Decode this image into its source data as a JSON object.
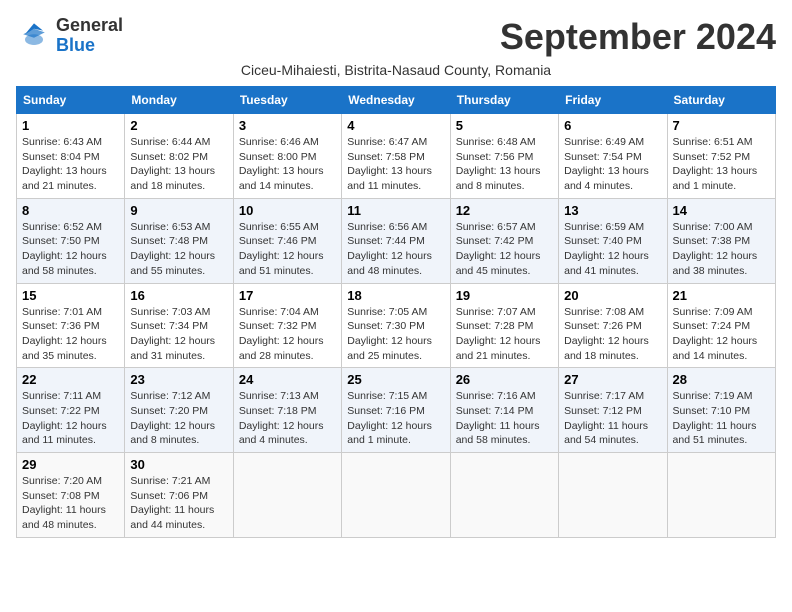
{
  "logo": {
    "line1": "General",
    "line2": "Blue"
  },
  "title": "September 2024",
  "location": "Ciceu-Mihaiesti, Bistrita-Nasaud County, Romania",
  "days_header": [
    "Sunday",
    "Monday",
    "Tuesday",
    "Wednesday",
    "Thursday",
    "Friday",
    "Saturday"
  ],
  "weeks": [
    [
      {
        "day": "1",
        "text": "Sunrise: 6:43 AM\nSunset: 8:04 PM\nDaylight: 13 hours and 21 minutes."
      },
      {
        "day": "2",
        "text": "Sunrise: 6:44 AM\nSunset: 8:02 PM\nDaylight: 13 hours and 18 minutes."
      },
      {
        "day": "3",
        "text": "Sunrise: 6:46 AM\nSunset: 8:00 PM\nDaylight: 13 hours and 14 minutes."
      },
      {
        "day": "4",
        "text": "Sunrise: 6:47 AM\nSunset: 7:58 PM\nDaylight: 13 hours and 11 minutes."
      },
      {
        "day": "5",
        "text": "Sunrise: 6:48 AM\nSunset: 7:56 PM\nDaylight: 13 hours and 8 minutes."
      },
      {
        "day": "6",
        "text": "Sunrise: 6:49 AM\nSunset: 7:54 PM\nDaylight: 13 hours and 4 minutes."
      },
      {
        "day": "7",
        "text": "Sunrise: 6:51 AM\nSunset: 7:52 PM\nDaylight: 13 hours and 1 minute."
      }
    ],
    [
      {
        "day": "8",
        "text": "Sunrise: 6:52 AM\nSunset: 7:50 PM\nDaylight: 12 hours and 58 minutes."
      },
      {
        "day": "9",
        "text": "Sunrise: 6:53 AM\nSunset: 7:48 PM\nDaylight: 12 hours and 55 minutes."
      },
      {
        "day": "10",
        "text": "Sunrise: 6:55 AM\nSunset: 7:46 PM\nDaylight: 12 hours and 51 minutes."
      },
      {
        "day": "11",
        "text": "Sunrise: 6:56 AM\nSunset: 7:44 PM\nDaylight: 12 hours and 48 minutes."
      },
      {
        "day": "12",
        "text": "Sunrise: 6:57 AM\nSunset: 7:42 PM\nDaylight: 12 hours and 45 minutes."
      },
      {
        "day": "13",
        "text": "Sunrise: 6:59 AM\nSunset: 7:40 PM\nDaylight: 12 hours and 41 minutes."
      },
      {
        "day": "14",
        "text": "Sunrise: 7:00 AM\nSunset: 7:38 PM\nDaylight: 12 hours and 38 minutes."
      }
    ],
    [
      {
        "day": "15",
        "text": "Sunrise: 7:01 AM\nSunset: 7:36 PM\nDaylight: 12 hours and 35 minutes."
      },
      {
        "day": "16",
        "text": "Sunrise: 7:03 AM\nSunset: 7:34 PM\nDaylight: 12 hours and 31 minutes."
      },
      {
        "day": "17",
        "text": "Sunrise: 7:04 AM\nSunset: 7:32 PM\nDaylight: 12 hours and 28 minutes."
      },
      {
        "day": "18",
        "text": "Sunrise: 7:05 AM\nSunset: 7:30 PM\nDaylight: 12 hours and 25 minutes."
      },
      {
        "day": "19",
        "text": "Sunrise: 7:07 AM\nSunset: 7:28 PM\nDaylight: 12 hours and 21 minutes."
      },
      {
        "day": "20",
        "text": "Sunrise: 7:08 AM\nSunset: 7:26 PM\nDaylight: 12 hours and 18 minutes."
      },
      {
        "day": "21",
        "text": "Sunrise: 7:09 AM\nSunset: 7:24 PM\nDaylight: 12 hours and 14 minutes."
      }
    ],
    [
      {
        "day": "22",
        "text": "Sunrise: 7:11 AM\nSunset: 7:22 PM\nDaylight: 12 hours and 11 minutes."
      },
      {
        "day": "23",
        "text": "Sunrise: 7:12 AM\nSunset: 7:20 PM\nDaylight: 12 hours and 8 minutes."
      },
      {
        "day": "24",
        "text": "Sunrise: 7:13 AM\nSunset: 7:18 PM\nDaylight: 12 hours and 4 minutes."
      },
      {
        "day": "25",
        "text": "Sunrise: 7:15 AM\nSunset: 7:16 PM\nDaylight: 12 hours and 1 minute."
      },
      {
        "day": "26",
        "text": "Sunrise: 7:16 AM\nSunset: 7:14 PM\nDaylight: 11 hours and 58 minutes."
      },
      {
        "day": "27",
        "text": "Sunrise: 7:17 AM\nSunset: 7:12 PM\nDaylight: 11 hours and 54 minutes."
      },
      {
        "day": "28",
        "text": "Sunrise: 7:19 AM\nSunset: 7:10 PM\nDaylight: 11 hours and 51 minutes."
      }
    ],
    [
      {
        "day": "29",
        "text": "Sunrise: 7:20 AM\nSunset: 7:08 PM\nDaylight: 11 hours and 48 minutes."
      },
      {
        "day": "30",
        "text": "Sunrise: 7:21 AM\nSunset: 7:06 PM\nDaylight: 11 hours and 44 minutes."
      },
      {
        "day": "",
        "text": ""
      },
      {
        "day": "",
        "text": ""
      },
      {
        "day": "",
        "text": ""
      },
      {
        "day": "",
        "text": ""
      },
      {
        "day": "",
        "text": ""
      }
    ]
  ]
}
